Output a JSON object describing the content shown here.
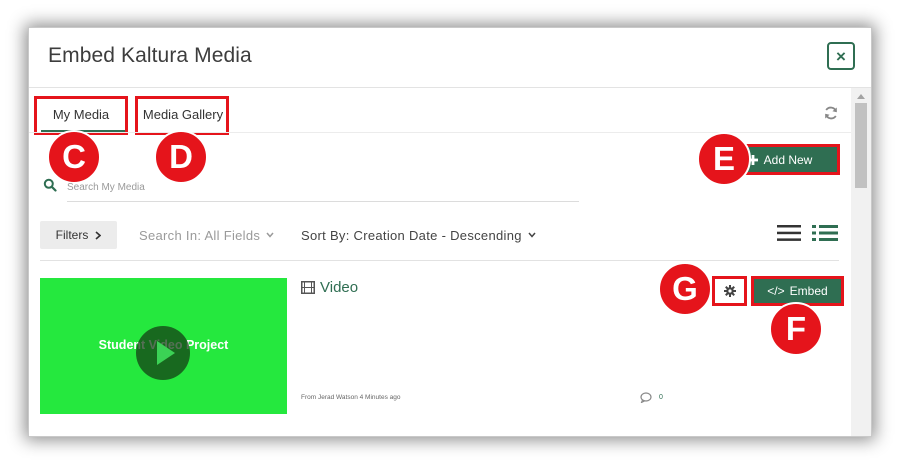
{
  "modal": {
    "title": "Embed Kaltura Media",
    "close_symbol": "×"
  },
  "tabs": [
    {
      "label": "My Media",
      "active": true
    },
    {
      "label": "Media Gallery",
      "active": false
    }
  ],
  "annotations": {
    "C": "C",
    "D": "D",
    "E": "E",
    "F": "F",
    "G": "G"
  },
  "search": {
    "placeholder": "Search My Media"
  },
  "toolbar": {
    "add_new_label": "Add New",
    "filters_label": "Filters",
    "search_in_label": "Search In: All Fields",
    "sort_by_label": "Sort By: Creation Date - Descending"
  },
  "entry": {
    "thumbnail_text": "Student Video Project",
    "title": "Video",
    "meta": "From Jerad Watson 4 Minutes ago",
    "comment_count": "0",
    "embed_label": "Embed",
    "embed_code_glyph": "</>"
  },
  "colors": {
    "brand_green": "#2f6e52",
    "annotation_red": "#e5141b",
    "thumbnail_green": "#25e83e"
  },
  "icons": [
    "refresh-icon",
    "search-icon",
    "plus-icon",
    "chevron-right-icon",
    "chevron-down-icon",
    "list-view-icon",
    "detail-view-icon",
    "film-icon",
    "comment-icon",
    "gear-icon",
    "play-icon",
    "close-icon"
  ]
}
